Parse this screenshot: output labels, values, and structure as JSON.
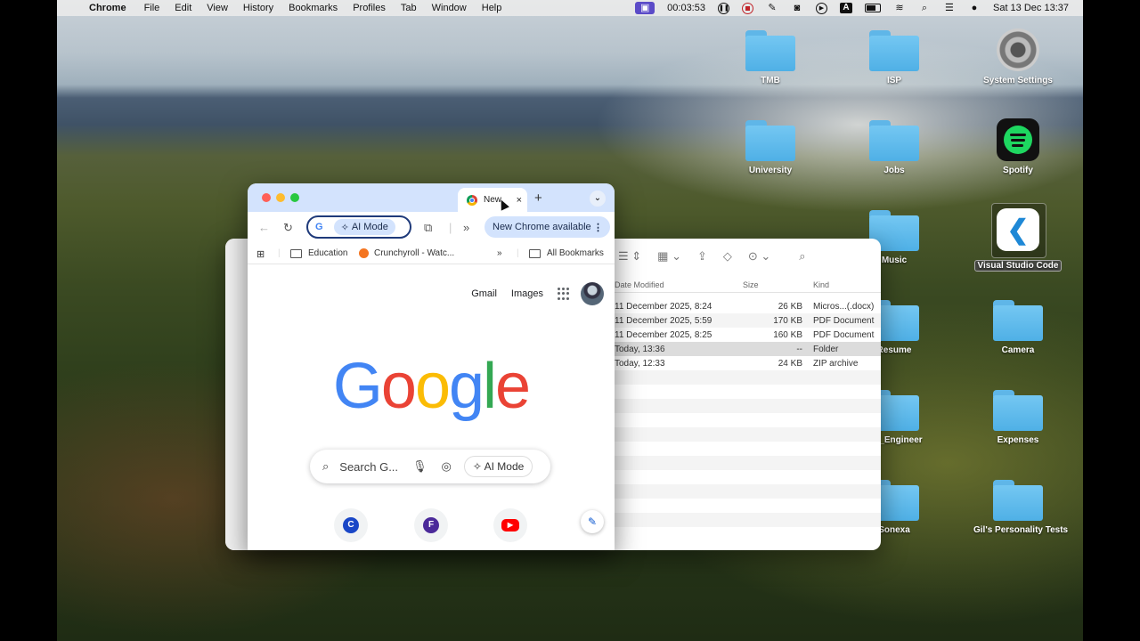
{
  "menubar": {
    "apple": "",
    "app": "Chrome",
    "menus": [
      "File",
      "Edit",
      "View",
      "History",
      "Bookmarks",
      "Profiles",
      "Tab",
      "Window",
      "Help"
    ],
    "timer": "00:03:53",
    "datetime": "Sat 13 Dec  13:37",
    "input_source": "A"
  },
  "desktop": {
    "items": [
      {
        "label": "TMB",
        "type": "folder"
      },
      {
        "label": "ISP",
        "type": "folder"
      },
      {
        "label": "System Settings",
        "type": "app",
        "icon": "gear-icon"
      },
      {
        "label": "University",
        "type": "folder"
      },
      {
        "label": "Jobs",
        "type": "folder"
      },
      {
        "label": "Spotify",
        "type": "app",
        "icon": "spotify-icon"
      },
      {
        "label": "Music",
        "type": "folder"
      },
      {
        "label": "Visual Studio Code",
        "type": "app",
        "icon": "vscode-icon"
      },
      {
        "label": "Resume",
        "type": "folder"
      },
      {
        "label": "Camera",
        "type": "folder"
      },
      {
        "label": "are_Engineer",
        "type": "folder"
      },
      {
        "label": "Expenses",
        "type": "folder"
      },
      {
        "label": "Sonexa",
        "type": "folder"
      },
      {
        "label": "Gil's Personality Tests",
        "type": "folder"
      }
    ]
  },
  "finder": {
    "columns": {
      "date": "Date Modified",
      "size": "Size",
      "kind": "Kind"
    },
    "rows": [
      {
        "date": "11 December 2025, 8:24",
        "size": "26 KB",
        "kind": "Micros...(.docx)"
      },
      {
        "date": "11 December 2025, 5:59",
        "size": "170 KB",
        "kind": "PDF Document"
      },
      {
        "date": "11 December 2025, 8:25",
        "size": "160 KB",
        "kind": "PDF Document"
      },
      {
        "date": "Today, 13:36",
        "size": "--",
        "kind": "Folder"
      },
      {
        "date": "Today, 12:33",
        "size": "24 KB",
        "kind": "ZIP archive"
      }
    ]
  },
  "chrome": {
    "tab_title": "New",
    "tab_close": "×",
    "new_tab": "+",
    "tab_menu": "⌄",
    "omnibox": {
      "g": "G",
      "ai_mode": "AI Mode"
    },
    "more": "»",
    "update": "New Chrome available",
    "bookmarks": {
      "education": "Education",
      "crunchyroll": "Crunchyroll - Watc...",
      "overflow": "»",
      "all": "All Bookmarks"
    },
    "ntp": {
      "gmail": "Gmail",
      "images": "Images",
      "search_placeholder": "Search G...",
      "ai_mode": "AI Mode",
      "shortcuts": [
        {
          "letter": "C",
          "color": "#1a47c7"
        },
        {
          "letter": "F",
          "color": "#4b2a9a"
        },
        {
          "letter": "▶",
          "color": "#ff0000"
        }
      ]
    },
    "google_logo": [
      {
        "ch": "G",
        "color": "#4285F4"
      },
      {
        "ch": "o",
        "color": "#EA4335"
      },
      {
        "ch": "o",
        "color": "#FBBC05"
      },
      {
        "ch": "g",
        "color": "#4285F4"
      },
      {
        "ch": "l",
        "color": "#34A853"
      },
      {
        "ch": "e",
        "color": "#EA4335"
      }
    ]
  }
}
